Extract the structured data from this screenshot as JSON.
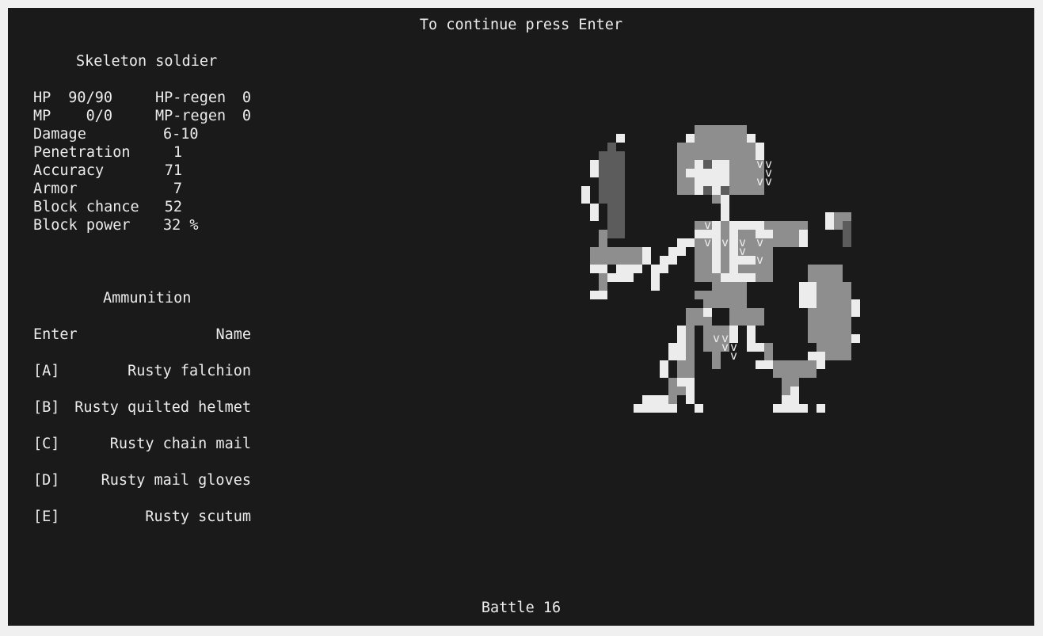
{
  "prompt": "To continue press Enter",
  "enemy": {
    "name": "Skeleton soldier",
    "stats": [
      {
        "label": "HP",
        "value": "90/90"
      },
      {
        "label": "MP",
        "value": "0/0"
      },
      {
        "label": "Damage",
        "value": "6-10"
      },
      {
        "label": "Penetration",
        "value": "1"
      },
      {
        "label": "Accuracy",
        "value": "71"
      },
      {
        "label": "Armor",
        "value": "7"
      },
      {
        "label": "Block chance",
        "value": "52"
      },
      {
        "label": "Block power",
        "value": "32 %"
      }
    ],
    "regen": [
      {
        "label": "HP-regen",
        "value": "0"
      },
      {
        "label": "MP-regen",
        "value": "0"
      }
    ]
  },
  "ammunition": {
    "title": "Ammunition",
    "col_enter": "Enter",
    "col_name": "Name",
    "items": [
      {
        "key": "[A]",
        "name": "Rusty falchion"
      },
      {
        "key": "[B]",
        "name": "Rusty quilted helmet"
      },
      {
        "key": "[C]",
        "name": "Rusty chain mail"
      },
      {
        "key": "[D]",
        "name": "Rusty mail gloves"
      },
      {
        "key": "[E]",
        "name": "Rusty scutum"
      }
    ]
  },
  "footer": "Battle 16",
  "colors": {
    "background": "#1a1a1a",
    "text": "#ececec",
    "sprite_mid": "#8e8e8e",
    "sprite_dark": "#5c5c5c"
  }
}
